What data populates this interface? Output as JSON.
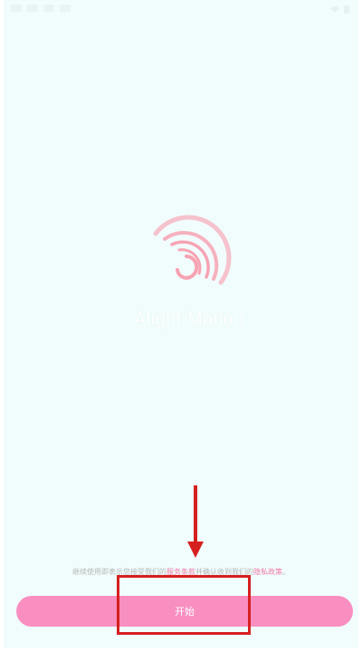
{
  "app": {
    "name": "Alight Motion"
  },
  "agreement": {
    "prefix": "继续使用即表示您接受我们的",
    "terms_link": "服务条款",
    "middle": "并确认收到我们的",
    "privacy_link": "隐私政策",
    "suffix": "。"
  },
  "start_button": {
    "label": "开始"
  },
  "colors": {
    "background": "#f1fdfd",
    "accent": "#f98ec0",
    "logo": "#f7a3b3",
    "annotation_red": "#d6201f"
  },
  "icons": {
    "logo": "alight-motion-logo",
    "arrow": "down-arrow-annotation"
  }
}
